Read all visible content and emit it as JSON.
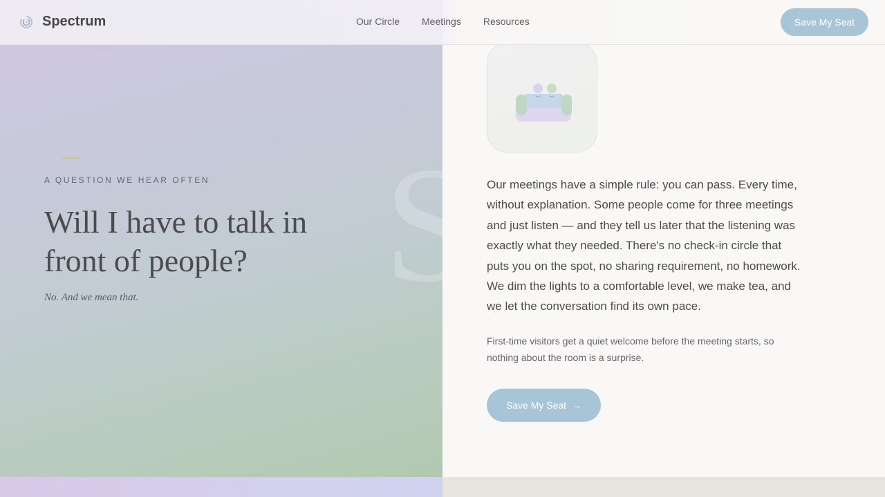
{
  "header": {
    "brand": "Spectrum",
    "logo_icon": "spiral-logo-icon",
    "nav": [
      {
        "label": "Our Circle"
      },
      {
        "label": "Meetings"
      },
      {
        "label": "Resources"
      }
    ],
    "cta_label": "Save My Seat"
  },
  "hero": {
    "eyebrow": "A QUESTION WE HEAR OFTEN",
    "headline": "Will I have to talk in front of people?",
    "answer": "No. And we mean that."
  },
  "content": {
    "illustration_icon": "sofa-with-people-icon",
    "body": "Our meetings have a simple rule: you can pass. Every time, without explanation. Some people come for three meetings and just listen — and they tell us later that the listening was exactly what they needed. There's no check-in circle that puts you on the spot, no sharing requirement, no homework. We dim the lights to a comfortable level, we make tea, and we let the conversation find its own pace.",
    "note": "First-time visitors get a quiet welcome before the meeting starts, so nothing about the room is a surprise.",
    "cta_label": "Save My Seat",
    "cta_icon": "arrow-right-icon"
  },
  "colors": {
    "accent": "#a8c5d8",
    "gradient_top": "#d2c8e2",
    "gradient_bottom": "#b2c9b0",
    "text": "#4b4b4b"
  }
}
